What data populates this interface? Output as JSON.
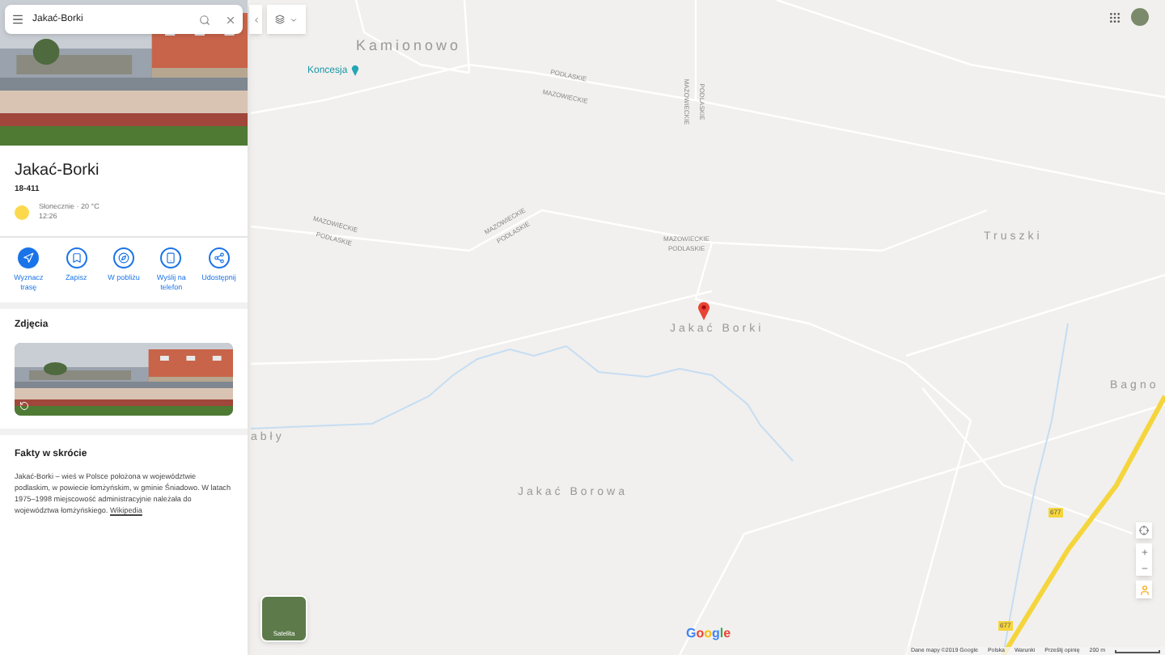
{
  "search": {
    "value": "Jakać-Borki"
  },
  "place": {
    "title": "Jakać-Borki",
    "postal": "18-411",
    "weather": "Słonecznie · 20 °C",
    "time": "12:26"
  },
  "actions": [
    {
      "label": "Wyznacz trasę",
      "kind": "route",
      "primary": true
    },
    {
      "label": "Zapisz",
      "kind": "save",
      "primary": false
    },
    {
      "label": "W pobliżu",
      "kind": "nearby",
      "primary": false
    },
    {
      "label": "Wyślij na telefon",
      "kind": "phone",
      "primary": false
    },
    {
      "label": "Udostępnij",
      "kind": "share",
      "primary": false
    }
  ],
  "photos": {
    "heading": "Zdjęcia"
  },
  "facts": {
    "heading": "Fakty w skrócie",
    "text": "Jakać-Borki – wieś w Polsce położona w województwie podlaskim, w powiecie łomżyńskim, w gminie Śniadowo. W latach 1975–1998 miejscowość administracyjnie należała do województwa łomżyńskiego.",
    "link": "Wikipedia"
  },
  "map": {
    "labels": [
      {
        "text": "Kamionowo",
        "kind": "town"
      },
      {
        "text": "Koncesja",
        "kind": "poi"
      },
      {
        "text": "PODLASKIE",
        "kind": "border"
      },
      {
        "text": "MAZOWIECKIE",
        "kind": "border"
      },
      {
        "text": "PODLASKIE",
        "kind": "border"
      },
      {
        "text": "MAZOWIECKIE",
        "kind": "border"
      },
      {
        "text": "MAZOWIECKIE",
        "kind": "border"
      },
      {
        "text": "PODLASKIE",
        "kind": "border"
      },
      {
        "text": "MAZOWIECKIE",
        "kind": "border"
      },
      {
        "text": "PODLASKIE",
        "kind": "border"
      },
      {
        "text": "MAZOWIECKIE",
        "kind": "border"
      },
      {
        "text": "PODLASKIE",
        "kind": "border"
      },
      {
        "text": "Truszki",
        "kind": "town"
      },
      {
        "text": "Jakać Borki",
        "kind": "town"
      },
      {
        "text": "Bagno",
        "kind": "town"
      },
      {
        "text": "abły",
        "kind": "town"
      },
      {
        "text": "Jakać Borowa",
        "kind": "town"
      },
      {
        "text": "677",
        "kind": "road"
      },
      {
        "text": "677",
        "kind": "road"
      }
    ],
    "satellite": "Satelita",
    "logo": "Google",
    "footer": [
      "Dane mapy ©2019 Google",
      "Polska",
      "Warunki",
      "Prześlij opinię"
    ],
    "scale": "200 m"
  }
}
